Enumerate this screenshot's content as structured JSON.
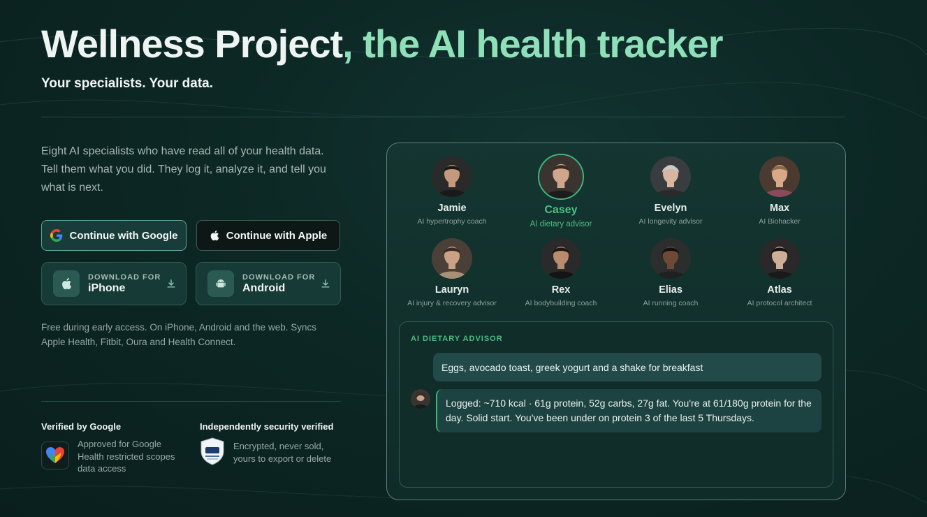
{
  "hero": {
    "title_main": "Wellness Project",
    "title_accent": ", the AI health tracker",
    "subtitle": "Your specialists. Your data."
  },
  "intro": "Eight AI specialists who have read all of your health data. Tell them what you did. They log it, analyze it, and tell you what is next.",
  "auth": {
    "google_label": "Continue with Google",
    "apple_label": "Continue with Apple"
  },
  "downloads": {
    "iphone": {
      "small": "DOWNLOAD FOR",
      "big": "iPhone"
    },
    "android": {
      "small": "DOWNLOAD FOR",
      "big": "Android"
    }
  },
  "fineprint": "Free during early access. On iPhone, Android and the web. Syncs Apple Health, Fitbit, Oura and Health Connect.",
  "trust": {
    "google": {
      "heading": "Verified by Google",
      "text": "Approved for Google Health restricted scopes data access"
    },
    "security": {
      "heading": "Independently security verified",
      "text": "Encrypted, never sold, yours to export or delete"
    }
  },
  "specialists": [
    {
      "name": "Jamie",
      "role": "AI hypertrophy coach"
    },
    {
      "name": "Casey",
      "role": "AI dietary advisor",
      "active": true
    },
    {
      "name": "Evelyn",
      "role": "AI longevity advisor"
    },
    {
      "name": "Max",
      "role": "AI Biohacker"
    },
    {
      "name": "Lauryn",
      "role": "AI injury & recovery advisor"
    },
    {
      "name": "Rex",
      "role": "AI bodybuilding coach"
    },
    {
      "name": "Elias",
      "role": "AI running coach"
    },
    {
      "name": "Atlas",
      "role": "AI protocol architect"
    }
  ],
  "chat": {
    "label": "AI DIETARY ADVISOR",
    "user_message": "Eggs, avocado toast, greek yogurt and a shake for breakfast",
    "ai_message": "Logged: ~710 kcal · 61g protein, 52g carbs, 27g fat. You're at 61/180g protein for the day. Solid start. You've been under on protein 3 of the last 5 Thursdays."
  },
  "colors": {
    "accent": "#8fe0b8",
    "active_green": "#49c184",
    "background": "#0c2724"
  }
}
